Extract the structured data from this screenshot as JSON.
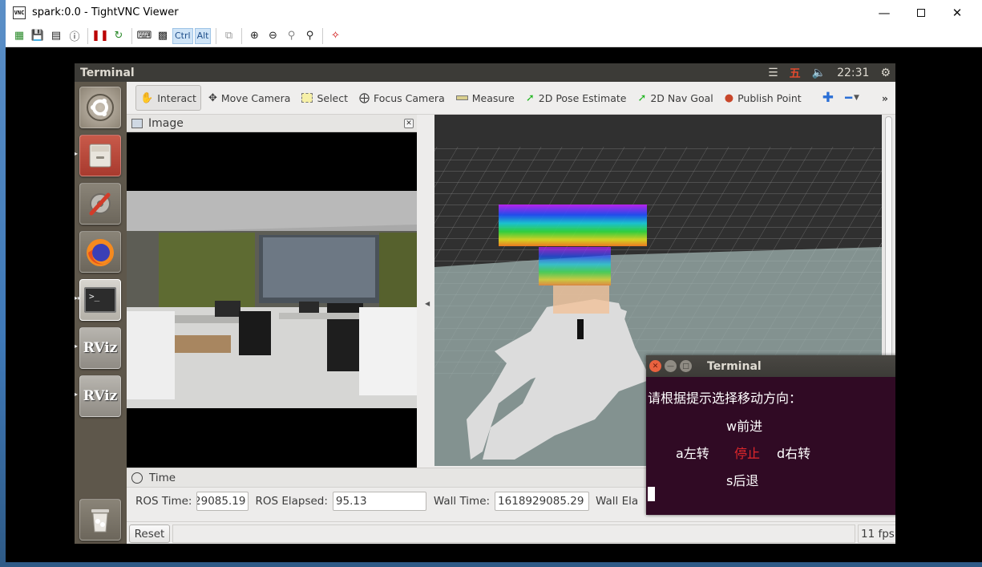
{
  "vnc": {
    "title": "spark:0.0 - TightVNC Viewer",
    "app_icon_text": "VNC",
    "toolbar": {
      "ctrl_label": "Ctrl",
      "alt_label": "Alt"
    }
  },
  "top_panel": {
    "title": "Terminal",
    "ime_indicator": "五",
    "clock": "22:31"
  },
  "launcher": {
    "items": [
      "ubuntu-dash",
      "file-manager",
      "system-settings",
      "firefox",
      "terminal",
      "rviz",
      "rviz",
      "trash"
    ],
    "rviz_label": "RViz"
  },
  "rviz": {
    "tools": [
      {
        "label": "Interact",
        "icon": "hand-icon"
      },
      {
        "label": "Move Camera",
        "icon": "move-camera-icon"
      },
      {
        "label": "Select",
        "icon": "select-icon"
      },
      {
        "label": "Focus Camera",
        "icon": "focus-camera-icon"
      },
      {
        "label": "Measure",
        "icon": "ruler-icon"
      },
      {
        "label": "2D Pose Estimate",
        "icon": "pose-arrow-icon"
      },
      {
        "label": "2D Nav Goal",
        "icon": "nav-arrow-icon"
      },
      {
        "label": "Publish Point",
        "icon": "map-pin-icon"
      }
    ],
    "image_panel": {
      "title": "Image"
    },
    "time_panel": {
      "title": "Time",
      "ros_time_label": "ROS Time:",
      "ros_time_value": "29085.19",
      "ros_elapsed_label": "ROS Elapsed:",
      "ros_elapsed_value": "95.13",
      "wall_time_label": "Wall Time:",
      "wall_time_value": "1618929085.29",
      "wall_elapsed_label": "Wall Ela",
      "reset_label": "Reset",
      "fps": "11 fps"
    }
  },
  "terminal": {
    "title": "Terminal",
    "prompt": "请根据提示选择移动方向：",
    "forward": "w前进",
    "left": "a左转",
    "stop": "停止",
    "right": "d右转",
    "back": "s后退",
    "stop_color": "#e0272b"
  }
}
